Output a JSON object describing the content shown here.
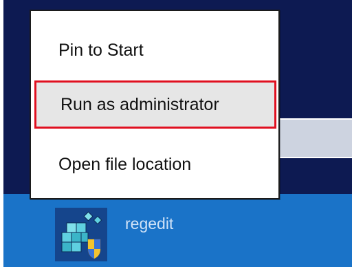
{
  "context_menu": {
    "items": [
      {
        "label": "Pin to Start"
      },
      {
        "label": "Run as administrator",
        "highlighted": true
      },
      {
        "label": "Open file location"
      }
    ]
  },
  "search_result": {
    "app_name": "regedit",
    "icon": "regedit-icon"
  },
  "colors": {
    "start_background": "#0d1a52",
    "result_band": "#1a73c8",
    "highlight_border": "#e01020",
    "search_strip": "#cdd3e0"
  }
}
